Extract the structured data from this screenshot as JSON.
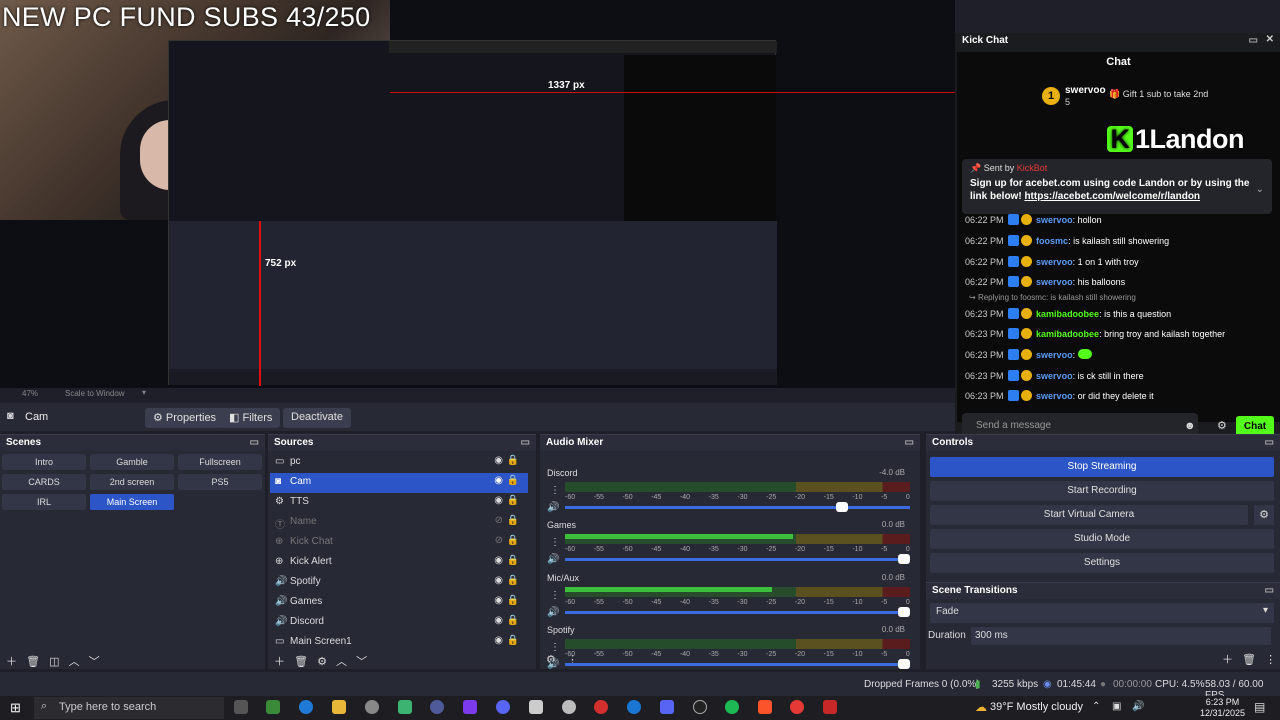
{
  "overlay": {
    "title": "NEW PC FUND SUBS 43/250"
  },
  "preview_labels": {
    "px_horizontal": "1337 px",
    "px_vertical": "752 px"
  },
  "kick_chat": {
    "window_title": "Kick Chat",
    "chat_title": "Chat",
    "top_sender": "swervoo",
    "top_sender_count": "5",
    "gift_text": "Gift 1 sub to take 2nd",
    "brand_logo": "1Landon",
    "pinned_sent_by": "Sent by",
    "pinned_bot": "KickBot",
    "pinned_message": "Sign up for acebet.com using code Landon or by using the link below!",
    "pinned_link": "https://acebet.com/welcome/r/landon",
    "reply_line": "Replying to foosmc: is kailash still showering",
    "messages": [
      {
        "time": "06:22 PM",
        "user": "swervoo",
        "text": "hollon"
      },
      {
        "time": "06:22 PM",
        "user": "foosmc",
        "text": "is kailash still showering"
      },
      {
        "time": "06:22 PM",
        "user": "swervoo",
        "text": "1 on 1 with troy"
      },
      {
        "time": "06:22 PM",
        "user": "swervoo",
        "text": "his balloons"
      },
      {
        "time": "06:23 PM",
        "user": "kamibadoobee",
        "text": "is this a question"
      },
      {
        "time": "06:23 PM",
        "user": "kamibadoobee",
        "text": "bring troy and kailash together"
      },
      {
        "time": "06:23 PM",
        "user": "swervoo",
        "text": ""
      },
      {
        "time": "06:23 PM",
        "user": "swervoo",
        "text": "is ck still in there"
      },
      {
        "time": "06:23 PM",
        "user": "swervoo",
        "text": "or did they delete it"
      }
    ],
    "send_placeholder": "Send a message",
    "chat_button": "Chat"
  },
  "source_bar": {
    "zoom": "47%",
    "mode": "Scale to Window"
  },
  "toolbar": {
    "source_name": "Cam",
    "properties": "Properties",
    "filters": "Filters",
    "deactivate": "Deactivate"
  },
  "scenes": {
    "title": "Scenes",
    "items": [
      "Intro",
      "Gamble",
      "Fullscreen",
      "CARDS",
      "2nd screen",
      "PS5",
      "IRL",
      "Main Screen"
    ],
    "selected": "Main Screen"
  },
  "sources": {
    "title": "Sources",
    "items": [
      "pc",
      "Cam",
      "TTS",
      "Name",
      "Kick Chat",
      "Kick Alert",
      "Spotify",
      "Games",
      "Discord",
      "Main Screen1"
    ]
  },
  "audio": {
    "title": "Audio Mixer",
    "channels": [
      {
        "name": "Discord",
        "db": "-4.0 dB",
        "level": 0.0,
        "volume": 0.82
      },
      {
        "name": "Games",
        "db": "0.0 dB",
        "level": 0.66,
        "volume": 1.0
      },
      {
        "name": "Mic/Aux",
        "db": "0.0 dB",
        "level": 0.6,
        "volume": 1.0
      },
      {
        "name": "Spotify",
        "db": "0.0 dB",
        "level": 0.0,
        "volume": 1.0
      }
    ],
    "ticks": [
      "-60",
      "-55",
      "-50",
      "-45",
      "-40",
      "-35",
      "-30",
      "-25",
      "-20",
      "-15",
      "-10",
      "-5",
      "0"
    ]
  },
  "controls": {
    "title": "Controls",
    "stop_streaming": "Stop Streaming",
    "start_recording": "Start Recording",
    "start_virtual_camera": "Start Virtual Camera",
    "studio_mode": "Studio Mode",
    "settings": "Settings"
  },
  "transitions": {
    "title": "Scene Transitions",
    "selected": "Fade",
    "duration_label": "Duration",
    "duration_value": "300 ms"
  },
  "status": {
    "dropped": "Dropped Frames 0 (0.0%)",
    "kbps": "3255 kbps",
    "stream_time": "01:45:44",
    "rec_time": "00:00:00",
    "cpu": "CPU: 4.5%",
    "fps": "58.03 / 60.00 FPS"
  },
  "taskbar": {
    "search_placeholder": "Type here to search",
    "weather": "39°F  Mostly cloudy",
    "time": "6:23 PM",
    "date": "12/31/2025"
  }
}
